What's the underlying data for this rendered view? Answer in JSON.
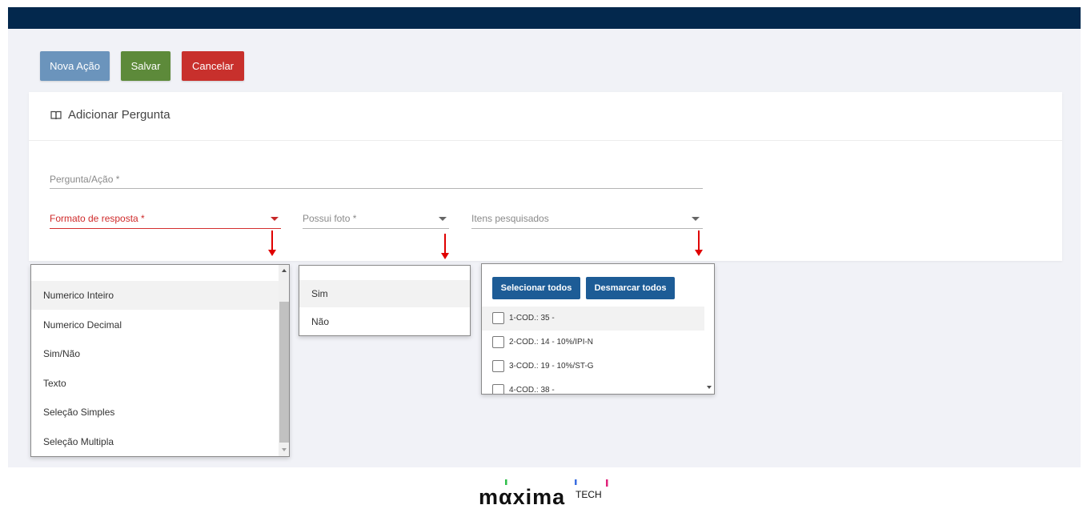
{
  "toolbar": {
    "nova_acao": "Nova Ação",
    "salvar": "Salvar",
    "cancelar": "Cancelar"
  },
  "card": {
    "icon": "book-open-icon",
    "title": "Adicionar Pergunta"
  },
  "form": {
    "pergunta_label": "Pergunta/Ação *",
    "formato_label": "Formato de resposta *",
    "possui_foto_label": "Possui foto *",
    "itens_label": "Itens pesquisados"
  },
  "formato_options": [
    "Numerico Inteiro",
    "Numerico Decimal",
    "Sim/Não",
    "Texto",
    "Seleção Simples",
    "Seleção Multipla"
  ],
  "foto_options": [
    "Sim",
    "Não"
  ],
  "itens": {
    "select_all": "Selecionar todos",
    "deselect_all": "Desmarcar todos",
    "items": [
      "1-COD.: 35 -",
      "2-COD.: 14 - 10%/IPI-N",
      "3-COD.: 19 - 10%/ST-G",
      "4-COD.: 38 -"
    ]
  },
  "colors": {
    "topbar": "#03284d",
    "nova_acao": "#6b94bc",
    "salvar": "#5d8a3a",
    "cancelar": "#c8302c",
    "select_button": "#1d5c96",
    "error_red": "#d32f2f"
  },
  "logo": {
    "word": "mαxima",
    "suffix": "TECH"
  }
}
